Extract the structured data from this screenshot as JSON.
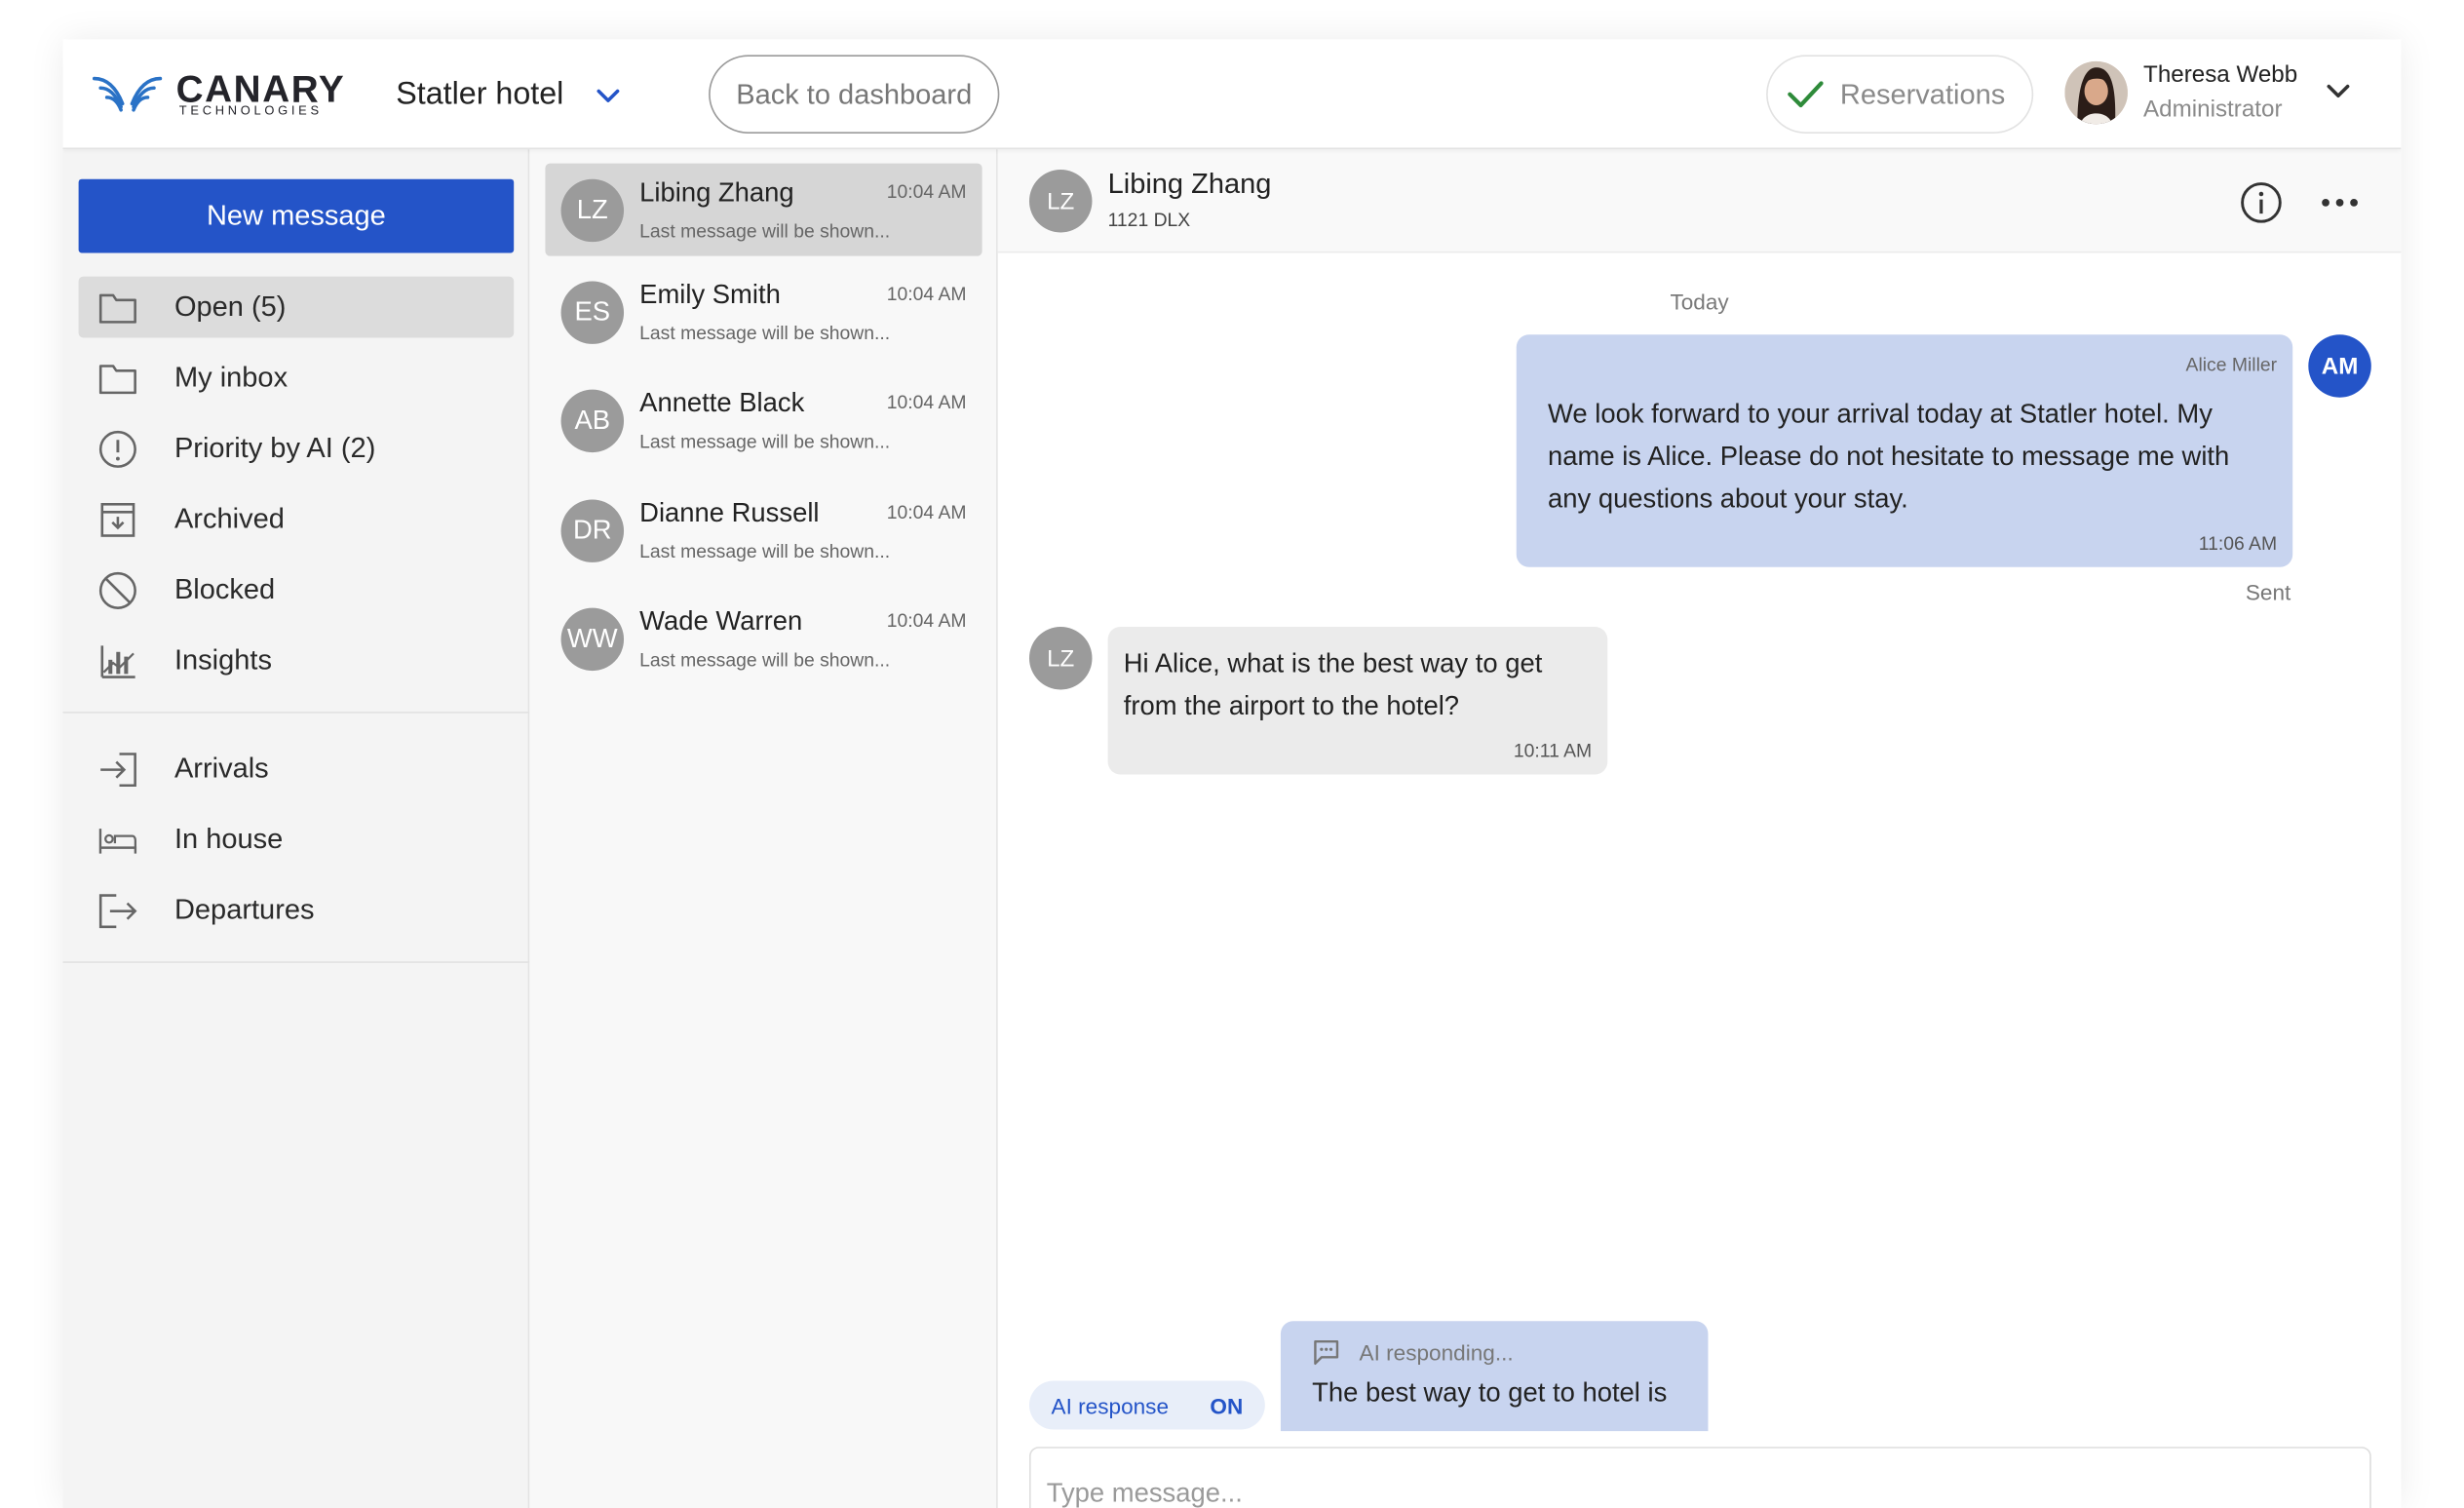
{
  "brand": {
    "name": "CANARY",
    "tagline": "TECHNOLOGIES"
  },
  "header": {
    "hotel": "Statler hotel",
    "back_button": "Back to dashboard",
    "reservations": "Reservations",
    "user": {
      "name": "Theresa Webb",
      "role": "Administrator"
    }
  },
  "sidebar": {
    "new_message": "New message",
    "folders": [
      {
        "label": "Open (5)",
        "icon": "folder-icon",
        "active": true
      },
      {
        "label": "My inbox",
        "icon": "folder-icon"
      },
      {
        "label": "Priority by AI (2)",
        "icon": "exclamation-circle-icon"
      },
      {
        "label": "Archived",
        "icon": "archive-icon"
      },
      {
        "label": "Blocked",
        "icon": "blocked-icon"
      },
      {
        "label": "Insights",
        "icon": "insights-icon"
      }
    ],
    "guests": [
      {
        "label": "Arrivals",
        "icon": "arrivals-icon"
      },
      {
        "label": "In house",
        "icon": "bed-icon"
      },
      {
        "label": "Departures",
        "icon": "departures-icon"
      }
    ]
  },
  "conversations": [
    {
      "initials": "LZ",
      "name": "Libing Zhang",
      "time": "10:04 AM",
      "preview": "Last message will be shown...",
      "active": true
    },
    {
      "initials": "ES",
      "name": "Emily Smith",
      "time": "10:04 AM",
      "preview": "Last message will be shown..."
    },
    {
      "initials": "AB",
      "name": "Annette Black",
      "time": "10:04 AM",
      "preview": "Last message will be shown..."
    },
    {
      "initials": "DR",
      "name": "Dianne Russell",
      "time": "10:04 AM",
      "preview": "Last message will be shown..."
    },
    {
      "initials": "WW",
      "name": "Wade Warren",
      "time": "10:04 AM",
      "preview": "Last message will be shown..."
    }
  ],
  "chat": {
    "guest": {
      "initials": "LZ",
      "name": "Libing Zhang",
      "room": "1121 DLX"
    },
    "day_label": "Today",
    "outgoing": {
      "sender": "Alice Miller",
      "initials": "AM",
      "text": "We look forward to your arrival today at Statler hotel. My name is Alice. Please do not hesitate to message me with any questions about your stay.",
      "time": "11:06 AM",
      "status": "Sent"
    },
    "incoming": {
      "initials": "LZ",
      "text": "Hi Alice, what is the best way to get from the airport to the hotel?",
      "time": "10:11 AM"
    },
    "ai_response": {
      "label": "AI response",
      "state": "ON"
    },
    "ai_draft": {
      "status": "AI responding...",
      "text": "The best way to get to hotel is"
    },
    "composer_placeholder": "Type message..."
  },
  "colors": {
    "accent": "#2454c8",
    "outgoing_bubble": "#c8d4ef",
    "incoming_bubble": "#ebebeb",
    "success": "#2e8b3a"
  }
}
